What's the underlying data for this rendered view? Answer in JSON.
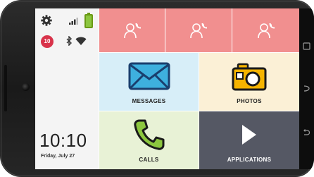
{
  "status": {
    "notification_count": "10",
    "time": "10:10",
    "date": "Friday, July 27"
  },
  "contacts": [
    {
      "icon": "add-contact-icon"
    },
    {
      "icon": "add-contact-icon"
    },
    {
      "icon": "add-contact-icon"
    }
  ],
  "tiles": {
    "messages": {
      "label": "MESSAGES",
      "color": "#d7eef8",
      "icon": "envelope-icon"
    },
    "photos": {
      "label": "PHOTOS",
      "color": "#fbf0d6",
      "icon": "camera-icon"
    },
    "calls": {
      "label": "CALLS",
      "color": "#e8f2d6",
      "icon": "phone-handset-icon"
    },
    "applications": {
      "label": "APPLICATIONS",
      "color": "#555864",
      "icon": "play-arrow-icon"
    }
  },
  "colors": {
    "contact_tile": "#f18f8f",
    "accent_green": "#8cc63f",
    "badge_red": "#d8334a"
  }
}
